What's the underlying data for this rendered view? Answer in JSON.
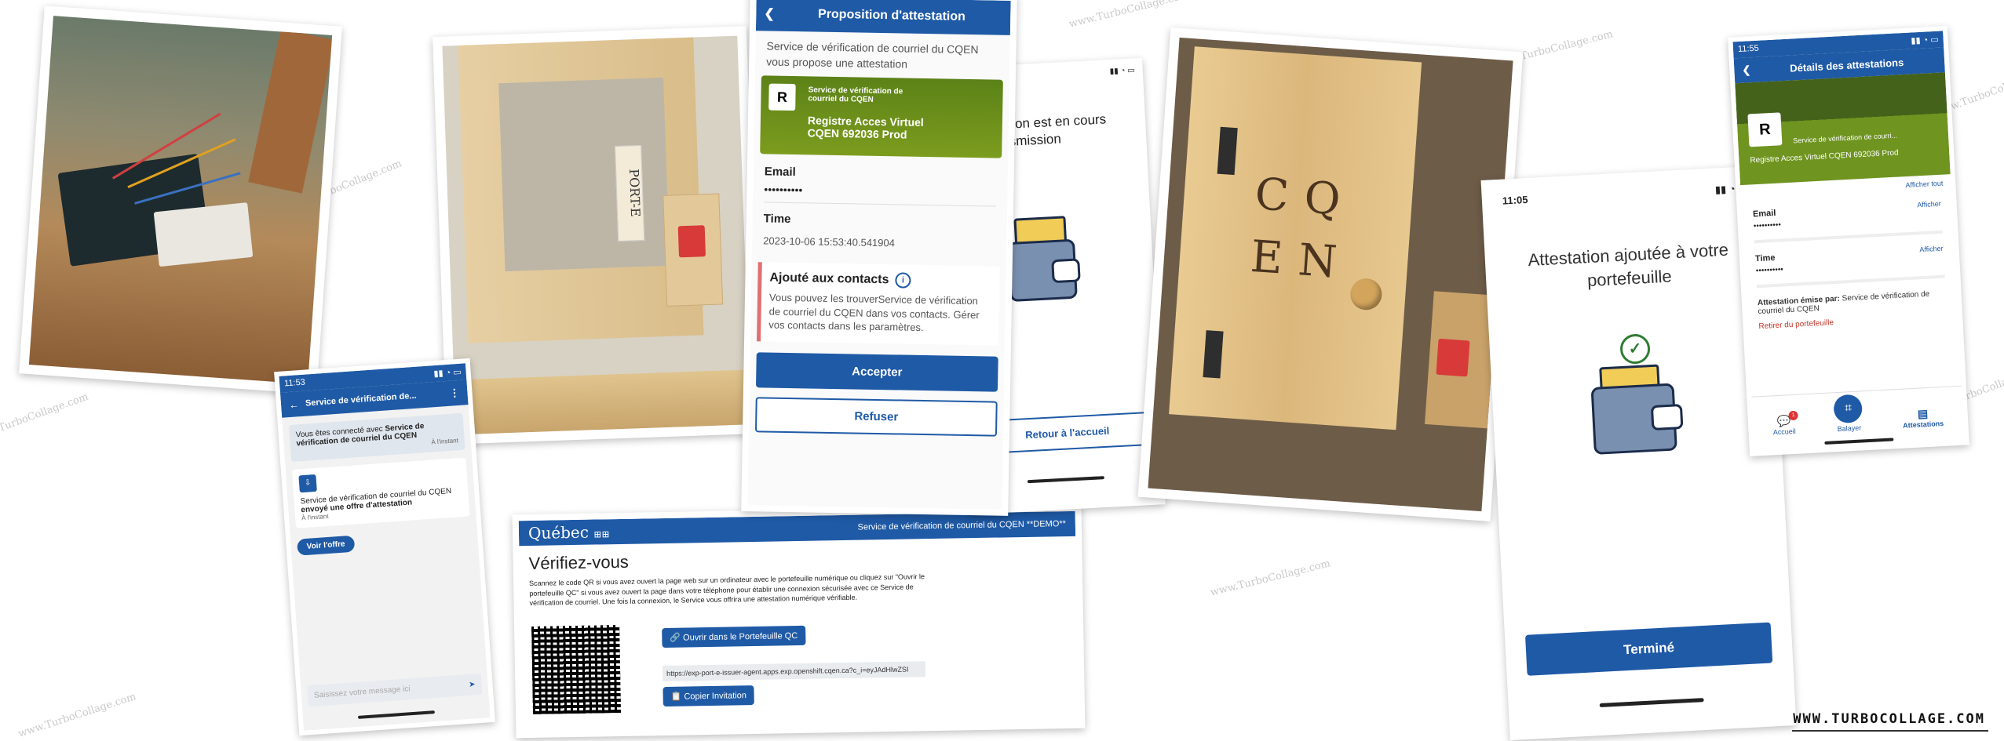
{
  "watermark": "www.TurboCollage.com",
  "brand": "WWW.TURBOCOLLAGE.COM",
  "chat_screen": {
    "time": "11:53",
    "title": "Service de vérification de...",
    "connected_prefix": "Vous êtes connecté avec",
    "connected_service": "Service de vérification de courriel du CQEN",
    "connected_time": "À l'instant",
    "offer_service": "Service de vérification de courriel du CQEN",
    "offer_text": "envoyé une offre d'attestation",
    "offer_time": "À l'instant",
    "view_offer": "Voir l'offre",
    "message_placeholder": "Saisissez votre message ici"
  },
  "proposal_screen": {
    "title": "Proposition d'attestation",
    "intro": "Service de vérification de courriel du CQEN vous propose une attestation",
    "card_avatar": "R",
    "card_issuer": "Service de vérification de courriel du CQEN",
    "card_name": "Registre Acces Virtuel CQEN 692036 Prod",
    "email_label": "Email",
    "email_value": "••••••••••",
    "time_label": "Time",
    "time_value": "2023-10-06 15:53:40.541904",
    "contacts_title": "Ajouté aux contacts",
    "contacts_text": "Vous pouvez les trouverService de vérification de courriel du CQEN dans vos contacts. Gérer vos contacts dans les paramètres.",
    "accept": "Accepter",
    "refuse": "Refuser"
  },
  "transmission_screen": {
    "text_line1": "ation est en cours",
    "text_line2": "nsmission",
    "back_home": "Retour à l'accueil"
  },
  "web_page": {
    "logo": "Québec",
    "header_title": "Service de vérification de courriel du CQEN **DEMO**",
    "heading": "Vérifiez-vous",
    "body": "Scannez le code QR si vous avez ouvert la page web sur un ordinateur avec le portefeuille numérique ou cliquez sur \"Ouvrir le portefeuille QC\" si vous avez ouvert la page dans votre téléphone pour établir une connexion sécurisée avec ce Service de vérification de courriel. Une fois la connexion, le Service vous offrira une attestation numérique vérifiable.",
    "open_wallet": "Ouvrir dans le Portefeuille QC",
    "invitation_url": "https://exp-port-e-issuer-agent.apps.exp.openshift.cqen.ca?c_i=eyJAdHlwZSI",
    "copy_invitation": "Copier Invitation"
  },
  "added_screen": {
    "time": "11:05",
    "message": "Attestation ajoutée à votre portefeuille",
    "done": "Terminé"
  },
  "details_screen": {
    "time": "11:55",
    "title": "Détails des attestations",
    "card_avatar": "R",
    "card_issuer": "Service de vérification de courri...",
    "card_name": "Registre Acces Virtuel CQEN 692036 Prod",
    "show_all": "Afficher tout",
    "email_label": "Email",
    "email_value": "••••••••••",
    "show": "Afficher",
    "time_label": "Time",
    "time_value": "••••••••••",
    "issued_by_label": "Attestation émise par:",
    "issued_by_value": "Service de vérification de courriel du CQEN",
    "remove": "Retirer du portefeuille",
    "nav_home": "Accueil",
    "nav_scan": "Balayer",
    "nav_credentials": "Attestations",
    "nav_badge": "1"
  },
  "photo_box": {
    "label": "PORT-E"
  },
  "photo_door": {
    "row1": "CQ",
    "row2": "EN"
  }
}
